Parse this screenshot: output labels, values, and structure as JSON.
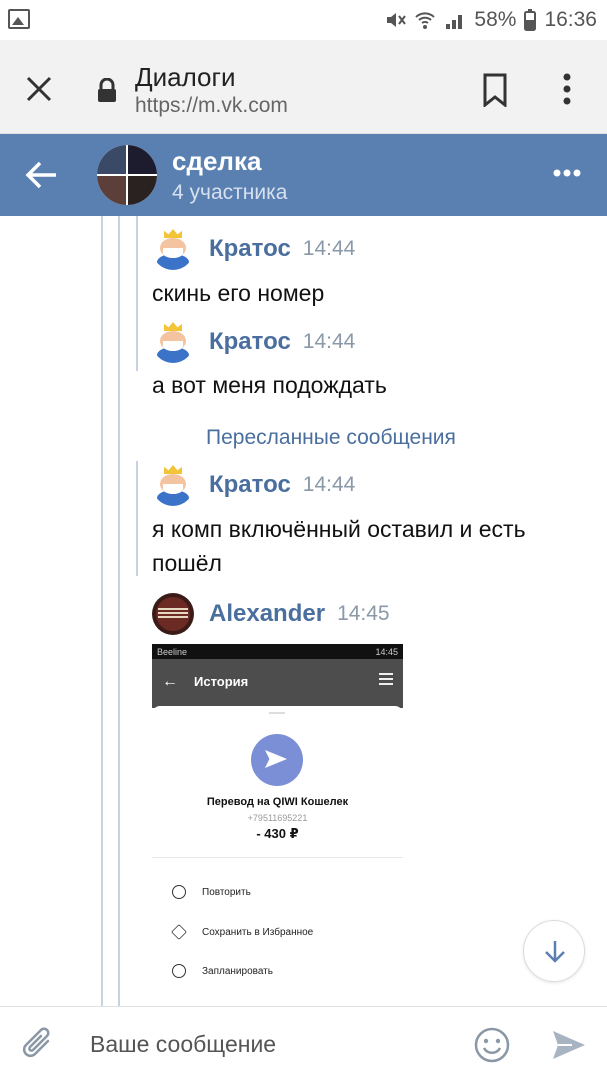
{
  "status_bar": {
    "battery": "58%",
    "time": "16:36"
  },
  "browser": {
    "title": "Диалоги",
    "url": "https://m.vk.com"
  },
  "header": {
    "title": "сделка",
    "subtitle": "4 участника"
  },
  "messages": [
    {
      "author": "Кратос",
      "time": "14:44",
      "text": "скинь его номер"
    },
    {
      "author": "Кратос",
      "time": "14:44",
      "text": "а вот меня подождать"
    },
    {
      "author": "Кратос",
      "time": "14:44",
      "text": "я комп включённый оставил и есть пошёл"
    },
    {
      "author": "Alexander",
      "time": "14:45"
    }
  ],
  "forwarded_label": "Пересланные сообщения",
  "attachment": {
    "carrier": "Beeline",
    "status_right": "14:45",
    "screen_title": "История",
    "transfer_title": "Перевод на QIWI Кошелек",
    "phone": "+79511695221",
    "amount": "- 430 ₽",
    "actions": [
      "Повторить",
      "Сохранить в Избранное",
      "Запланировать"
    ]
  },
  "composer": {
    "placeholder": "Ваше сообщение"
  },
  "colors": {
    "vk_blue": "#5a80b2",
    "link_blue": "#4a6f9e"
  }
}
